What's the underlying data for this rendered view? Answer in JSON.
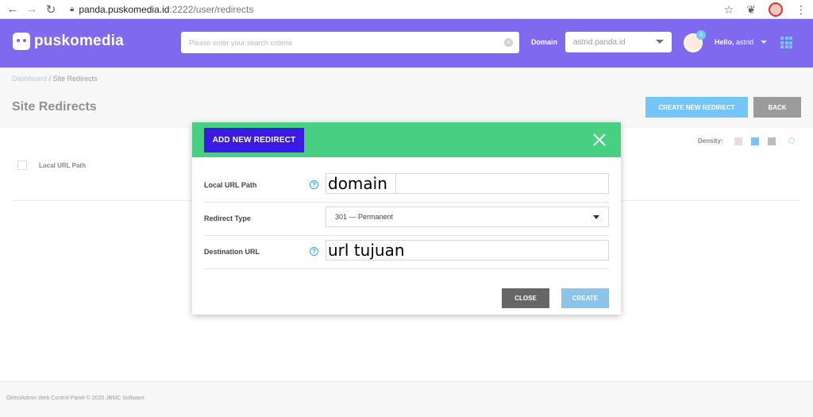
{
  "browser": {
    "url_host": "panda.puskomedia.id",
    "url_path": ":2222/user/redirects"
  },
  "header": {
    "brand": "puskomedia",
    "search_placeholder": "Please enter your search criteria",
    "domain_label": "Domain",
    "domain_value": "astrid.panda.id",
    "notification_count": "1",
    "greeting": "Hello,",
    "username": "astrid"
  },
  "breadcrumb": {
    "root": "Dashboard",
    "separator": " / ",
    "current": "Site Redirects"
  },
  "page": {
    "title": "Site Redirects",
    "create_new_label": "CREATE NEW REDIRECT",
    "back_label": "BACK",
    "density_label": "Density:",
    "column_local_url": "Local URL Path"
  },
  "modal": {
    "tab_label": "ADD NEW REDIRECT",
    "fields": {
      "local_label": "Local URL Path",
      "local_value": "domain",
      "type_label": "Redirect Type",
      "type_value": "301 — Permanent",
      "dest_label": "Destination URL",
      "dest_value": "url tujuan"
    },
    "close_label": "CLOSE",
    "create_label": "CREATE"
  },
  "footer": {
    "text": "DirectAdmin Web Control Panel © 2020 JBMC Software"
  },
  "colors": {
    "header_bg": "#3b1ae6",
    "modal_header_bg": "#47cf82",
    "primary_blue": "#2aa8f5"
  }
}
